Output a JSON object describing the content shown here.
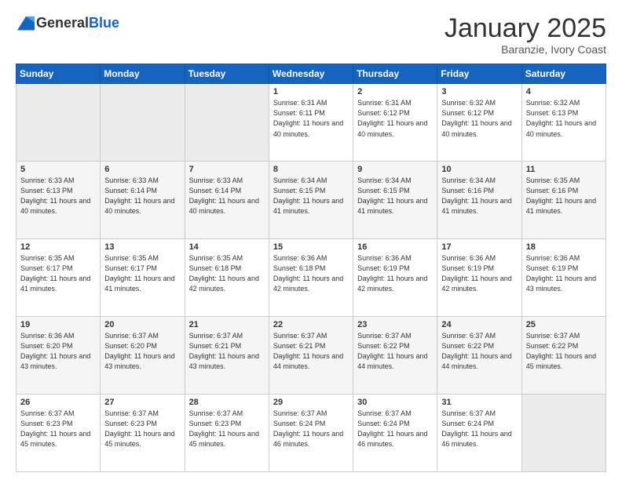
{
  "header": {
    "logo": {
      "general": "General",
      "blue": "Blue"
    },
    "title": "January 2025",
    "location": "Baranzie, Ivory Coast"
  },
  "weekdays": [
    "Sunday",
    "Monday",
    "Tuesday",
    "Wednesday",
    "Thursday",
    "Friday",
    "Saturday"
  ],
  "weeks": [
    [
      {
        "day": "",
        "empty": true
      },
      {
        "day": "",
        "empty": true
      },
      {
        "day": "",
        "empty": true
      },
      {
        "day": "1",
        "sunrise": "Sunrise: 6:31 AM",
        "sunset": "Sunset: 6:11 PM",
        "daylight": "Daylight: 11 hours and 40 minutes."
      },
      {
        "day": "2",
        "sunrise": "Sunrise: 6:31 AM",
        "sunset": "Sunset: 6:12 PM",
        "daylight": "Daylight: 11 hours and 40 minutes."
      },
      {
        "day": "3",
        "sunrise": "Sunrise: 6:32 AM",
        "sunset": "Sunset: 6:12 PM",
        "daylight": "Daylight: 11 hours and 40 minutes."
      },
      {
        "day": "4",
        "sunrise": "Sunrise: 6:32 AM",
        "sunset": "Sunset: 6:13 PM",
        "daylight": "Daylight: 11 hours and 40 minutes."
      }
    ],
    [
      {
        "day": "5",
        "sunrise": "Sunrise: 6:33 AM",
        "sunset": "Sunset: 6:13 PM",
        "daylight": "Daylight: 11 hours and 40 minutes."
      },
      {
        "day": "6",
        "sunrise": "Sunrise: 6:33 AM",
        "sunset": "Sunset: 6:14 PM",
        "daylight": "Daylight: 11 hours and 40 minutes."
      },
      {
        "day": "7",
        "sunrise": "Sunrise: 6:33 AM",
        "sunset": "Sunset: 6:14 PM",
        "daylight": "Daylight: 11 hours and 40 minutes."
      },
      {
        "day": "8",
        "sunrise": "Sunrise: 6:34 AM",
        "sunset": "Sunset: 6:15 PM",
        "daylight": "Daylight: 11 hours and 41 minutes."
      },
      {
        "day": "9",
        "sunrise": "Sunrise: 6:34 AM",
        "sunset": "Sunset: 6:15 PM",
        "daylight": "Daylight: 11 hours and 41 minutes."
      },
      {
        "day": "10",
        "sunrise": "Sunrise: 6:34 AM",
        "sunset": "Sunset: 6:16 PM",
        "daylight": "Daylight: 11 hours and 41 minutes."
      },
      {
        "day": "11",
        "sunrise": "Sunrise: 6:35 AM",
        "sunset": "Sunset: 6:16 PM",
        "daylight": "Daylight: 11 hours and 41 minutes."
      }
    ],
    [
      {
        "day": "12",
        "sunrise": "Sunrise: 6:35 AM",
        "sunset": "Sunset: 6:17 PM",
        "daylight": "Daylight: 11 hours and 41 minutes."
      },
      {
        "day": "13",
        "sunrise": "Sunrise: 6:35 AM",
        "sunset": "Sunset: 6:17 PM",
        "daylight": "Daylight: 11 hours and 41 minutes."
      },
      {
        "day": "14",
        "sunrise": "Sunrise: 6:35 AM",
        "sunset": "Sunset: 6:18 PM",
        "daylight": "Daylight: 11 hours and 42 minutes."
      },
      {
        "day": "15",
        "sunrise": "Sunrise: 6:36 AM",
        "sunset": "Sunset: 6:18 PM",
        "daylight": "Daylight: 11 hours and 42 minutes."
      },
      {
        "day": "16",
        "sunrise": "Sunrise: 6:36 AM",
        "sunset": "Sunset: 6:19 PM",
        "daylight": "Daylight: 11 hours and 42 minutes."
      },
      {
        "day": "17",
        "sunrise": "Sunrise: 6:36 AM",
        "sunset": "Sunset: 6:19 PM",
        "daylight": "Daylight: 11 hours and 42 minutes."
      },
      {
        "day": "18",
        "sunrise": "Sunrise: 6:36 AM",
        "sunset": "Sunset: 6:19 PM",
        "daylight": "Daylight: 11 hours and 43 minutes."
      }
    ],
    [
      {
        "day": "19",
        "sunrise": "Sunrise: 6:36 AM",
        "sunset": "Sunset: 6:20 PM",
        "daylight": "Daylight: 11 hours and 43 minutes."
      },
      {
        "day": "20",
        "sunrise": "Sunrise: 6:37 AM",
        "sunset": "Sunset: 6:20 PM",
        "daylight": "Daylight: 11 hours and 43 minutes."
      },
      {
        "day": "21",
        "sunrise": "Sunrise: 6:37 AM",
        "sunset": "Sunset: 6:21 PM",
        "daylight": "Daylight: 11 hours and 43 minutes."
      },
      {
        "day": "22",
        "sunrise": "Sunrise: 6:37 AM",
        "sunset": "Sunset: 6:21 PM",
        "daylight": "Daylight: 11 hours and 44 minutes."
      },
      {
        "day": "23",
        "sunrise": "Sunrise: 6:37 AM",
        "sunset": "Sunset: 6:22 PM",
        "daylight": "Daylight: 11 hours and 44 minutes."
      },
      {
        "day": "24",
        "sunrise": "Sunrise: 6:37 AM",
        "sunset": "Sunset: 6:22 PM",
        "daylight": "Daylight: 11 hours and 44 minutes."
      },
      {
        "day": "25",
        "sunrise": "Sunrise: 6:37 AM",
        "sunset": "Sunset: 6:22 PM",
        "daylight": "Daylight: 11 hours and 45 minutes."
      }
    ],
    [
      {
        "day": "26",
        "sunrise": "Sunrise: 6:37 AM",
        "sunset": "Sunset: 6:23 PM",
        "daylight": "Daylight: 11 hours and 45 minutes."
      },
      {
        "day": "27",
        "sunrise": "Sunrise: 6:37 AM",
        "sunset": "Sunset: 6:23 PM",
        "daylight": "Daylight: 11 hours and 45 minutes."
      },
      {
        "day": "28",
        "sunrise": "Sunrise: 6:37 AM",
        "sunset": "Sunset: 6:23 PM",
        "daylight": "Daylight: 11 hours and 45 minutes."
      },
      {
        "day": "29",
        "sunrise": "Sunrise: 6:37 AM",
        "sunset": "Sunset: 6:24 PM",
        "daylight": "Daylight: 11 hours and 46 minutes."
      },
      {
        "day": "30",
        "sunrise": "Sunrise: 6:37 AM",
        "sunset": "Sunset: 6:24 PM",
        "daylight": "Daylight: 11 hours and 46 minutes."
      },
      {
        "day": "31",
        "sunrise": "Sunrise: 6:37 AM",
        "sunset": "Sunset: 6:24 PM",
        "daylight": "Daylight: 11 hours and 46 minutes."
      },
      {
        "day": "",
        "empty": true
      }
    ]
  ]
}
